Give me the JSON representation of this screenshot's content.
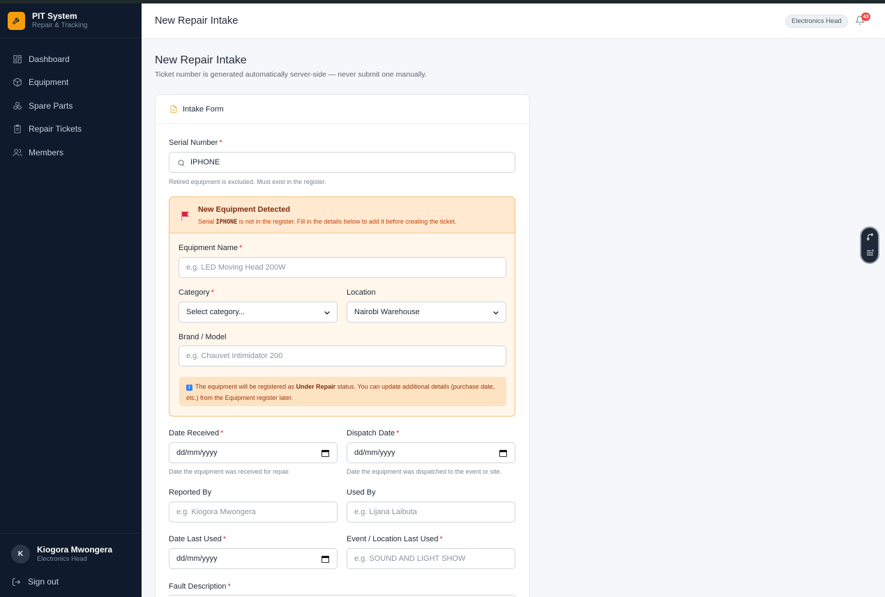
{
  "app": {
    "name": "PIT System",
    "subtitle": "Repair & Tracking"
  },
  "sidebar": {
    "items": [
      {
        "label": "Dashboard",
        "icon": "grid-icon"
      },
      {
        "label": "Equipment",
        "icon": "box-icon"
      },
      {
        "label": "Spare Parts",
        "icon": "parts-icon"
      },
      {
        "label": "Repair Tickets",
        "icon": "clipboard-icon"
      },
      {
        "label": "Members",
        "icon": "users-icon"
      }
    ],
    "user": {
      "initial": "K",
      "name": "Kiogora Mwongera",
      "role": "Electronics Head"
    },
    "signout": "Sign out"
  },
  "header": {
    "title": "New Repair Intake",
    "role": "Electronics Head",
    "notifications": "43"
  },
  "page": {
    "title": "New Repair Intake",
    "subtitle": "Ticket number is generated automatically server-side — never submit one manually."
  },
  "form": {
    "card_title": "Intake Form",
    "serial": {
      "label": "Serial Number",
      "required": "*",
      "value": "IPHONE",
      "hint": "Retired equipment is excluded. Must exist in the register."
    },
    "new_equipment": {
      "title": "New Equipment Detected",
      "sub_prefix": "Serial ",
      "sub_serial": "IPHONE",
      "sub_suffix": " is not in the register. Fill in the details below to add it before creating the ticket.",
      "name": {
        "label": "Equipment Name",
        "required": "*",
        "placeholder": "e.g. LED Moving Head 200W"
      },
      "category": {
        "label": "Category",
        "required": "*",
        "value": "Select category..."
      },
      "location": {
        "label": "Location",
        "value": "Nairobi Warehouse"
      },
      "brand": {
        "label": "Brand / Model",
        "placeholder": "e.g. Chauvet Intimidator 200"
      },
      "notice_prefix": "The equipment will be registered as ",
      "notice_bold": "Under Repair",
      "notice_suffix": " status. You can update additional details (purchase date, etc.) from the Equipment register later."
    },
    "date_received": {
      "label": "Date Received",
      "required": "*",
      "value": "dd/mm/yyyy",
      "hint": "Date the equipment was received for repair."
    },
    "dispatch_date": {
      "label": "Dispatch Date",
      "required": "*",
      "value": "dd/mm/yyyy",
      "hint": "Date the equipment was dispatched to the event or site."
    },
    "reported_by": {
      "label": "Reported By",
      "placeholder": "e.g. Kiogora Mwongera"
    },
    "used_by": {
      "label": "Used By",
      "placeholder": "e.g. Lijana Laibuta"
    },
    "date_last_used": {
      "label": "Date Last Used",
      "required": "*",
      "value": "dd/mm/yyyy"
    },
    "event_location": {
      "label": "Event / Location Last Used",
      "required": "*",
      "placeholder": "e.g. SOUND AND LIGHT SHOW"
    },
    "fault": {
      "label": "Fault Description",
      "required": "*"
    }
  },
  "colors": {
    "sidebar": "#0f1a2c",
    "accent": "#f59e0b",
    "warning_bg": "#fff6ec",
    "badge": "#ef4444"
  }
}
